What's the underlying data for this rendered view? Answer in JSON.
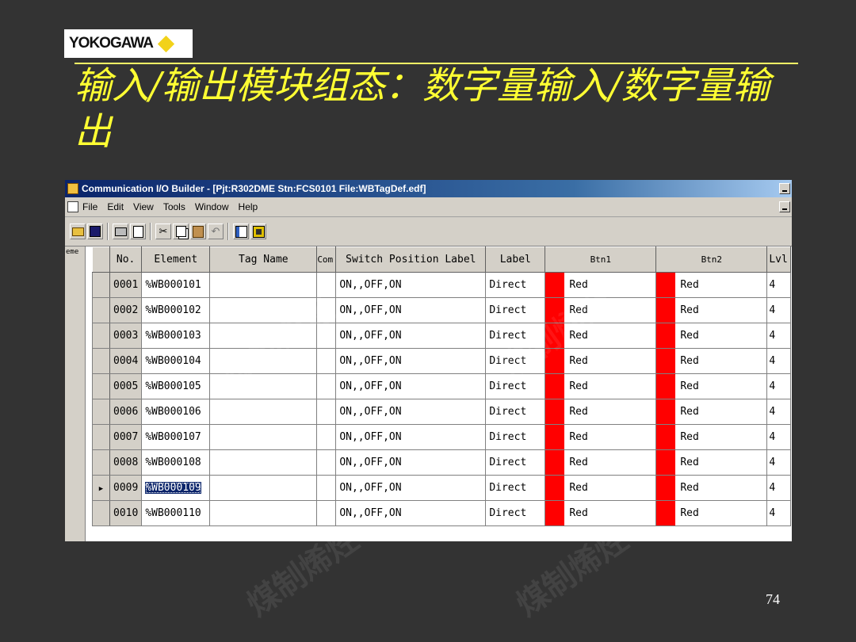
{
  "logo": {
    "text": "YOKOGAWA"
  },
  "slide": {
    "title": "输入/输出模块组态：数字量输入/数字量输出",
    "page_number": "74"
  },
  "app": {
    "window_title": "Communication I/O Builder - [Pjt:R302DME Stn:FCS0101 File:WBTagDef.edf]",
    "menu": [
      "File",
      "Edit",
      "View",
      "Tools",
      "Window",
      "Help"
    ],
    "left_strip_label": "eme",
    "columns": [
      "No.",
      "Element",
      "Tag Name",
      "Com",
      "Switch Position Label",
      "Label",
      "Btn1",
      "Btn2",
      "Lvl"
    ],
    "swatch_color": "#ff0000",
    "rows": [
      {
        "no": "0001",
        "element": "%WB000101",
        "tag": "",
        "com": "",
        "switch": "ON,,OFF,ON",
        "label": "Direct",
        "btn1": "Red",
        "btn2": "Red",
        "lvl": "4"
      },
      {
        "no": "0002",
        "element": "%WB000102",
        "tag": "",
        "com": "",
        "switch": "ON,,OFF,ON",
        "label": "Direct",
        "btn1": "Red",
        "btn2": "Red",
        "lvl": "4"
      },
      {
        "no": "0003",
        "element": "%WB000103",
        "tag": "",
        "com": "",
        "switch": "ON,,OFF,ON",
        "label": "Direct",
        "btn1": "Red",
        "btn2": "Red",
        "lvl": "4"
      },
      {
        "no": "0004",
        "element": "%WB000104",
        "tag": "",
        "com": "",
        "switch": "ON,,OFF,ON",
        "label": "Direct",
        "btn1": "Red",
        "btn2": "Red",
        "lvl": "4"
      },
      {
        "no": "0005",
        "element": "%WB000105",
        "tag": "",
        "com": "",
        "switch": "ON,,OFF,ON",
        "label": "Direct",
        "btn1": "Red",
        "btn2": "Red",
        "lvl": "4"
      },
      {
        "no": "0006",
        "element": "%WB000106",
        "tag": "",
        "com": "",
        "switch": "ON,,OFF,ON",
        "label": "Direct",
        "btn1": "Red",
        "btn2": "Red",
        "lvl": "4"
      },
      {
        "no": "0007",
        "element": "%WB000107",
        "tag": "",
        "com": "",
        "switch": "ON,,OFF,ON",
        "label": "Direct",
        "btn1": "Red",
        "btn2": "Red",
        "lvl": "4"
      },
      {
        "no": "0008",
        "element": "%WB000108",
        "tag": "",
        "com": "",
        "switch": "ON,,OFF,ON",
        "label": "Direct",
        "btn1": "Red",
        "btn2": "Red",
        "lvl": "4"
      },
      {
        "no": "0009",
        "element": "%WB000109",
        "tag": "",
        "com": "",
        "switch": "ON,,OFF,ON",
        "label": "Direct",
        "btn1": "Red",
        "btn2": "Red",
        "lvl": "4",
        "current": true
      },
      {
        "no": "0010",
        "element": "%WB000110",
        "tag": "",
        "com": "",
        "switch": "ON,,OFF,ON",
        "label": "Direct",
        "btn1": "Red",
        "btn2": "Red",
        "lvl": "4"
      }
    ]
  }
}
